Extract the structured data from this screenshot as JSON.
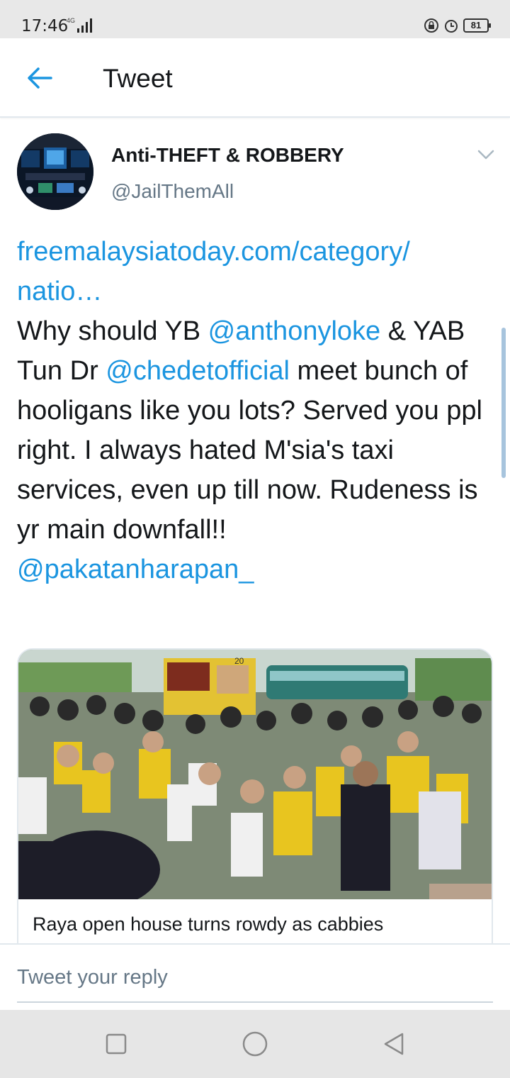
{
  "status_bar": {
    "time": "17:46",
    "network": "4G",
    "battery": "81",
    "icons": [
      "signal-icon",
      "lock-rotation-icon",
      "alarm-icon",
      "battery-icon"
    ]
  },
  "header": {
    "title": "Tweet",
    "back_icon": "arrow-left-icon"
  },
  "tweet": {
    "display_name": "Anti-THEFT & ROBBERY",
    "handle": "@JailThemAll",
    "link_line1": "freemalaysiatoday.com/category/",
    "link_line2": "natio…",
    "text_1": "Why should YB ",
    "mention_1": "@anthonyloke",
    "text_2": " & YAB Tun Dr ",
    "mention_2": "@chedetofficial",
    "text_3": " meet bunch of hooligans like you lots? Served you ppl right. I always hated M'sia's taxi services, even up till now. Rudeness is yr main downfall!!",
    "mention_3": "@pakatanharapan_",
    "card_title": "Raya open house turns rowdy as cabbies",
    "banner_text": "20"
  },
  "reply": {
    "placeholder": "Tweet your reply"
  },
  "nav_bar": {
    "buttons": [
      "recents-icon",
      "home-icon",
      "back-triangle-icon"
    ]
  },
  "colors": {
    "accent": "#1b95e0",
    "text": "#14171a",
    "muted": "#657786"
  }
}
